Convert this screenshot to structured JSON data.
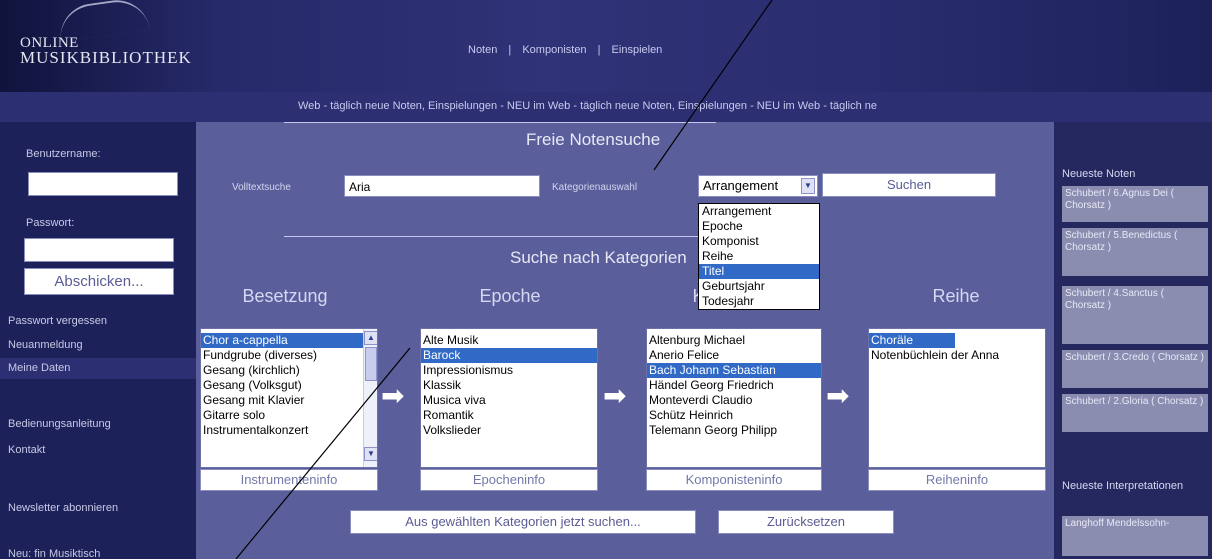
{
  "header": {
    "logo_line1": "ONLINE",
    "logo_line2": "MUSIKBIBLIOTHEK",
    "nav": [
      "Noten",
      "Komponisten",
      "Einspielen"
    ],
    "nav_sep": "|"
  },
  "ticker": "Web - täglich neue Noten, Einspielungen - NEU im Web - täglich neue Noten, Einspielungen - NEU im Web - täglich ne",
  "sidebar": {
    "username_label": "Benutzername:",
    "password_label": "Passwort:",
    "submit_label": "Abschicken...",
    "links": [
      "Passwort vergessen",
      "Neuanmeldung",
      "Meine Daten"
    ],
    "manual_label": "Bedienungsanleitung",
    "contact_label": "Kontakt",
    "newsletter_label": "Newsletter abonnieren",
    "bottom_label": "Neu: fin Musiktisch"
  },
  "search": {
    "title": "Freie Notensuche",
    "fulltext_label": "Volltextsuche",
    "fulltext_value": "Aria",
    "category_label": "Kategorienauswahl",
    "category_selected": "Arrangement",
    "category_options": [
      "Arrangement",
      "Epoche",
      "Komponist",
      "Reihe",
      "Titel",
      "Geburtsjahr",
      "Todesjahr"
    ],
    "category_highlighted_index": 4,
    "search_button": "Suchen"
  },
  "categories": {
    "title": "Suche nach Kategorien",
    "columns": [
      {
        "heading": "Besetzung",
        "items": [
          "Chor a-cappella",
          "Fundgrube (diverses)",
          "Gesang (kirchlich)",
          "Gesang (Volksgut)",
          "Gesang mit Klavier",
          "Gitarre solo",
          "Instrumentalkonzert"
        ],
        "selected": 0,
        "info_label": "Instrumenteninfo"
      },
      {
        "heading": "Epoche",
        "items": [
          "Alte Musik",
          "Barock",
          "Impressionismus",
          "Klassik",
          "Musica viva",
          "Romantik",
          "Volkslieder"
        ],
        "selected": 1,
        "info_label": "Epocheninfo"
      },
      {
        "heading": "Komponist",
        "items": [
          "Altenburg Michael",
          "Anerio Felice",
          "Bach Johann Sebastian",
          "Händel Georg Friedrich",
          "Monteverdi Claudio",
          "Schütz Heinrich",
          "Telemann Georg Philipp"
        ],
        "selected": 2,
        "info_label": "Komponisteninfo"
      },
      {
        "heading": "Reihe",
        "items": [
          "Choräle",
          "Notenbüchlein der Anna"
        ],
        "selected": 0,
        "info_label": "Reiheninfo"
      }
    ],
    "search_selected_button": "Aus gewählten Kategorien jetzt suchen...",
    "reset_button": "Zurücksetzen"
  },
  "right": {
    "newest_notes_title": "Neueste Noten",
    "newest_notes": [
      "Schubert / 6.Agnus Dei ( Chorsatz )",
      "Schubert / 5.Benedictus ( Chorsatz )",
      "Schubert / 4.Sanctus ( Chorsatz )",
      "Schubert / 3.Credo ( Chorsatz )",
      "Schubert / 2.Gloria ( Chorsatz )"
    ],
    "newest_interp_title": "Neueste Interpretationen",
    "newest_interp": [
      "Langhoff Mendelssohn-"
    ]
  },
  "colors": {
    "main_panel": "#5a5f9b",
    "sidebar": "#1d2159",
    "selection": "#3169c6"
  }
}
